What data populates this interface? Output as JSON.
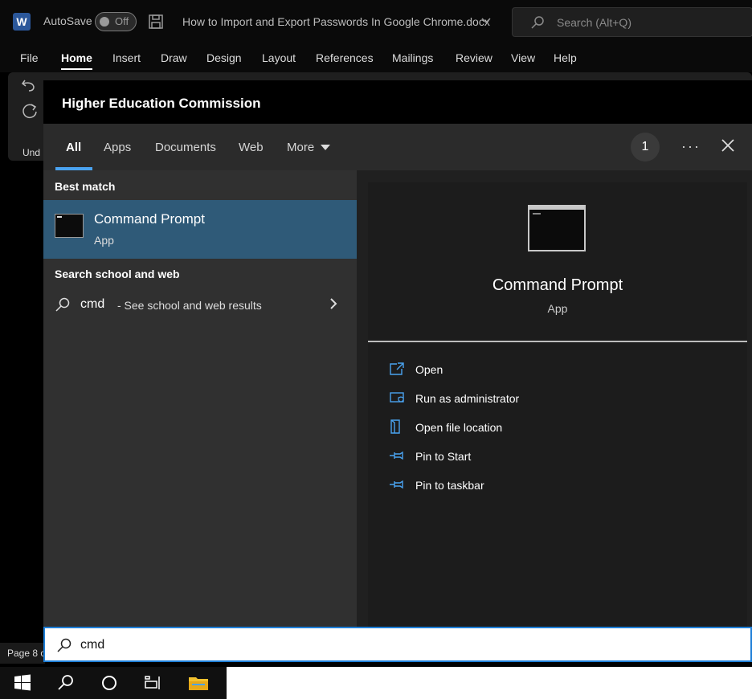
{
  "word": {
    "autosave_label": "AutoSave",
    "autosave_state": "Off",
    "document_title": "How to Import and Export Passwords In Google Chrome.docx",
    "search_placeholder": "Search (Alt+Q)",
    "ribbon_tabs": [
      "File",
      "Home",
      "Insert",
      "Draw",
      "Design",
      "Layout",
      "References",
      "Mailings",
      "Review",
      "View",
      "Help"
    ],
    "active_tab": "Home",
    "undo_label": "Und",
    "status": "Page 8 o"
  },
  "search_panel": {
    "header_title": "Higher Education Commission",
    "tabs": [
      "All",
      "Apps",
      "Documents",
      "Web",
      "More"
    ],
    "active_tab": "All",
    "badge_count": "1",
    "more_options": "···",
    "best_match_label": "Best match",
    "best_match": {
      "name": "Command Prompt",
      "type": "App"
    },
    "web_section_label": "Search school and web",
    "web_result": {
      "query": "cmd",
      "suffix": "- See school and web results"
    },
    "detail": {
      "name": "Command Prompt",
      "type": "App",
      "actions": [
        "Open",
        "Run as administrator",
        "Open file location",
        "Pin to Start",
        "Pin to taskbar"
      ]
    },
    "search_value": "cmd"
  },
  "colors": {
    "accent": "#1e7fd8",
    "selected_row": "#2f5a78",
    "tab_underline": "#4aa3f0",
    "word_blue": "#2b579a",
    "folder_yellow": "#f2c12e"
  }
}
